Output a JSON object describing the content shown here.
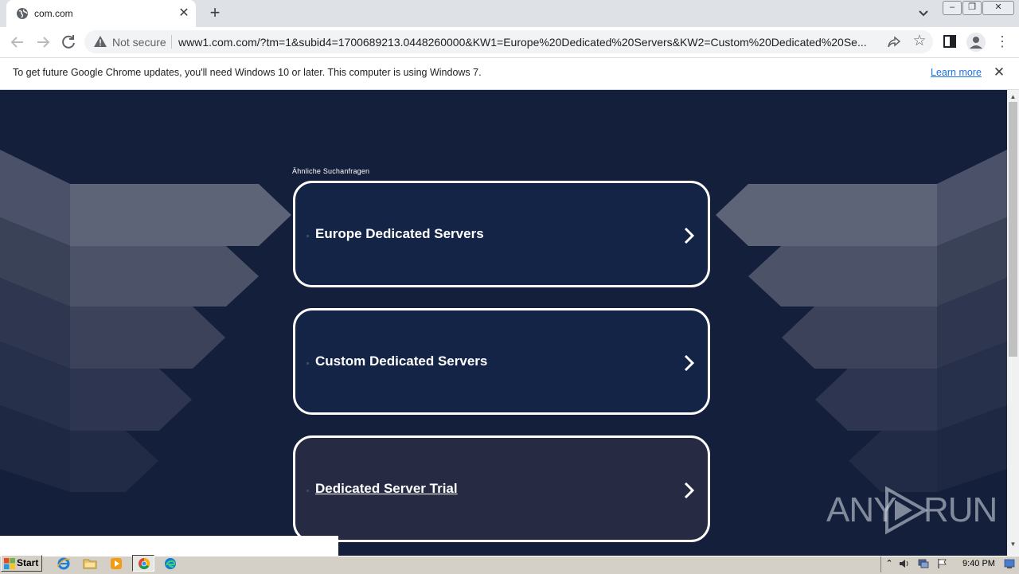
{
  "browser": {
    "tab_title": "com.com",
    "new_tab_symbol": "+",
    "close_symbol": "✕",
    "window_controls": {
      "minimize": "–",
      "maximize": "❐",
      "close": "✕"
    },
    "security_label": "Not secure",
    "url": "www1.com.com/?tm=1&subid4=1700689213.0448260000&KW1=Europe%20Dedicated%20Servers&KW2=Custom%20Dedicated%20Se...",
    "star_symbol": "☆",
    "menu_symbol": "⋮"
  },
  "infobar": {
    "message": "To get future Google Chrome updates, you'll need Windows 10 or later. This computer is using Windows 7.",
    "link_label": "Learn more",
    "close_symbol": "✕"
  },
  "page": {
    "related_label": "Ähnliche Suchanfragen",
    "cards": [
      {
        "label": "Europe Dedicated Servers"
      },
      {
        "label": "Custom Dedicated Servers"
      },
      {
        "label": "Dedicated Server Trial"
      }
    ],
    "watermark": {
      "left": "ANY",
      "right": "RUN"
    }
  },
  "scrollbar": {
    "up": "▲",
    "down": "▼"
  },
  "taskbar": {
    "start_label": "Start",
    "tray_arrow": "⌃",
    "clock": "9:40 PM"
  },
  "colors": {
    "page_bg": "#131f3b",
    "card_bg": "#142447",
    "card_highlight_bg": "#262b43",
    "card_border": "#ffffff",
    "link": "#1a73e8"
  },
  "icons": [
    "globe-icon",
    "close-icon",
    "plus-icon",
    "chevron-down-icon",
    "back-arrow-icon",
    "forward-arrow-icon",
    "reload-icon",
    "warning-icon",
    "share-icon",
    "star-icon",
    "side-panel-icon",
    "profile-icon",
    "kebab-menu-icon",
    "chevron-right-icon",
    "windows-logo-icon",
    "ie-icon",
    "folder-icon",
    "media-player-icon",
    "chrome-icon",
    "edge-icon",
    "volume-icon",
    "network-icon",
    "flag-icon"
  ]
}
